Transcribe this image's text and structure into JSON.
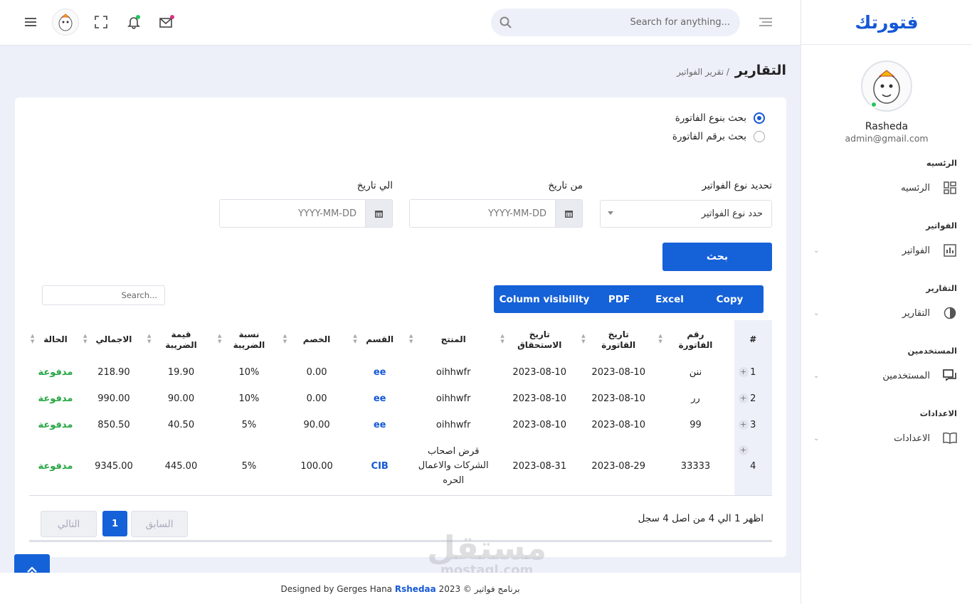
{
  "brand": {
    "name": "فتورتك",
    "color": "#1558d6"
  },
  "header": {
    "search_placeholder": "Search for anything..."
  },
  "profile": {
    "name": "Rasheda",
    "email": "admin@gmail.com"
  },
  "sidebar": {
    "sections": [
      {
        "title": "الرئسيه",
        "item": "الرئسيه",
        "icon": "dashboard-icon"
      },
      {
        "title": "الفواتير",
        "item": "الفواتير",
        "icon": "bar-chart-icon"
      },
      {
        "title": "التقارير",
        "item": "التقارير",
        "icon": "pie-chart-icon"
      },
      {
        "title": "المستخدمين",
        "item": "المستخدمين",
        "icon": "chat-icon"
      },
      {
        "title": "الاعدادات",
        "item": "الاعدادات",
        "icon": "book-icon"
      }
    ]
  },
  "breadcrumb": {
    "title": "التقارير",
    "sub": "/ تقرير الفواتير"
  },
  "filters": {
    "radio1": "بحث بنوع الفاتورة",
    "radio2": "بحث برقم الفاتورة",
    "type_label": "تحديد نوع الفواتير",
    "type_value": "حدد نوع الفواتير",
    "from_label": "من تاريخ",
    "to_label": "الي تاريخ",
    "date_placeholder": "YYYY-MM-DD",
    "search_button": "بحث"
  },
  "toolbar": {
    "copy": "Copy",
    "excel": "Excel",
    "pdf": "PDF",
    "colvis": "Column visibility",
    "table_search_placeholder": "Search..."
  },
  "table": {
    "headers": {
      "hash": "#",
      "inv_no": "رقم الفاتورة",
      "inv_date": "تاريخ القاتورة",
      "due_date": "تاريخ الاستحقاق",
      "product": "المنتج",
      "section": "القسم",
      "discount": "الخصم",
      "tax_rate": "نسبة الضريبة",
      "tax_value": "قيمة الضريبة",
      "total": "الاجمالي",
      "status": "الحالة"
    },
    "rows": [
      {
        "n": "1",
        "inv_no": "ننن",
        "inv_date": "2023-08-10",
        "due_date": "2023-08-10",
        "product": "oihhwfr",
        "section": "ee",
        "discount": "0.00",
        "tax_rate": "10%",
        "tax_value": "19.90",
        "total": "218.90",
        "status": "مدفوعة"
      },
      {
        "n": "2",
        "inv_no": "رر",
        "inv_date": "2023-08-10",
        "due_date": "2023-08-10",
        "product": "oihhwfr",
        "section": "ee",
        "discount": "0.00",
        "tax_rate": "10%",
        "tax_value": "90.00",
        "total": "990.00",
        "status": "مدفوعة"
      },
      {
        "n": "3",
        "inv_no": "99",
        "inv_date": "2023-08-10",
        "due_date": "2023-08-10",
        "product": "oihhwfr",
        "section": "ee",
        "discount": "90.00",
        "tax_rate": "5%",
        "tax_value": "40.50",
        "total": "850.50",
        "status": "مدفوعة"
      },
      {
        "n": "4",
        "inv_no": "33333",
        "inv_date": "2023-08-29",
        "due_date": "2023-08-31",
        "product_l1": "قرض اصحاب",
        "product_l2": "الشركات والاعمال",
        "product_l3": "الحره",
        "section": "CIB",
        "discount": "100.00",
        "tax_rate": "5%",
        "tax_value": "445.00",
        "total": "9345.00",
        "status": "مدفوعة"
      }
    ]
  },
  "pagination": {
    "info": "اظهر 1 الي 4 من اصل 4 سجل",
    "prev": "السابق",
    "page": "1",
    "next": "التالي"
  },
  "watermark": {
    "line1": "مستقل",
    "line2": "mostaql.com"
  },
  "footer": {
    "prefix": "برنامج فواتير © 2023",
    "designed": "Designed by Gerges Hana",
    "author": "Rshedaa"
  }
}
